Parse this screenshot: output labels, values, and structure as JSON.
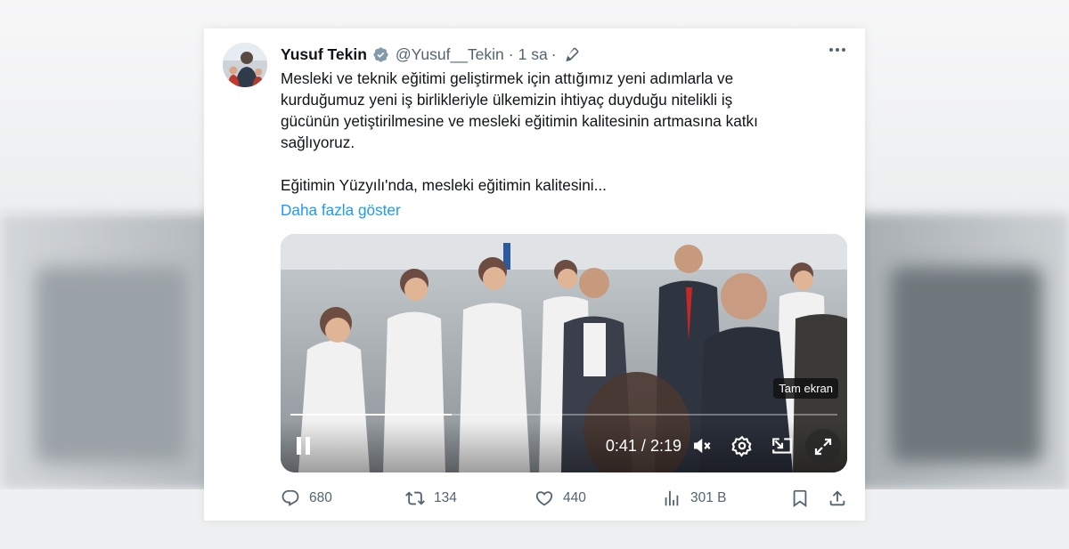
{
  "tweet": {
    "author_name": "Yusuf Tekin",
    "handle": "@Yusuf__Tekin",
    "separator": "·",
    "time": "1 sa",
    "time_separator": "·",
    "text_paragraph_1": "Mesleki ve teknik eğitimi geliştirmek için attığımız yeni adımlarla ve\nkurduğumuz yeni iş birlikleriyle ülkemizin ihtiyaç duyduğu nitelikli iş\ngücünün yetiştirilmesine ve mesleki eğitimin kalitesinin artmasına katkı\nsağlıyoruz.",
    "text_paragraph_2": "Eğitimin Yüzyılı'nda, mesleki eğitimin kalitesini...",
    "show_more": "Daha fazla göster"
  },
  "video": {
    "current_time": "0:41",
    "time_separator": "/",
    "duration": "2:19",
    "progress_fraction": 0.295,
    "tooltip": "Tam ekran"
  },
  "actions": {
    "replies": "680",
    "reposts": "134",
    "likes": "440",
    "views": "301 B"
  },
  "icons": {
    "verified": "verified-badge-icon",
    "edit": "edit-pencil-icon",
    "more": "more-dots-icon",
    "reply": "reply-icon",
    "repost": "repost-icon",
    "like": "heart-icon",
    "views": "views-bar-icon",
    "bookmark": "bookmark-icon",
    "share": "share-icon"
  },
  "colors": {
    "accent": "#1d9bf0",
    "text_primary": "#0f1419",
    "text_secondary": "#536471"
  }
}
